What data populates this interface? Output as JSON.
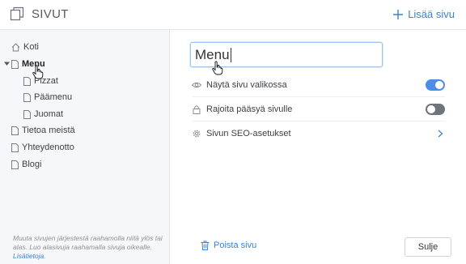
{
  "header": {
    "title": "SIVUT",
    "add_label": "Lisää sivu"
  },
  "sidebar": {
    "items": [
      {
        "label": "Koti",
        "icon": "home-icon"
      },
      {
        "label": "Menu",
        "icon": "page-icon",
        "active": true,
        "expanded": true
      },
      {
        "label": "Pizzat",
        "icon": "page-icon"
      },
      {
        "label": "Päämenu",
        "icon": "page-icon"
      },
      {
        "label": "Juomat",
        "icon": "page-icon"
      },
      {
        "label": "Tietoa meistä",
        "icon": "page-icon"
      },
      {
        "label": "Yhteydenotto",
        "icon": "page-icon"
      },
      {
        "label": "Blogi",
        "icon": "page-icon"
      }
    ],
    "note": {
      "text": "Muuta sivujen järjestestä raahamolla niitä ylös tai alas. Luo alasivuja raahamalla sivuja oikealle.",
      "link": "Lisätietoja."
    }
  },
  "editor": {
    "page_name_value": "Menu",
    "settings": [
      {
        "label": "Näytä sivu valikossa",
        "icon": "eye-icon",
        "control": "toggle",
        "on": true
      },
      {
        "label": "Rajoita pääsyä sivulle",
        "icon": "lock-icon",
        "control": "toggle",
        "on": false
      },
      {
        "label": "Sivun SEO-asetukset",
        "icon": "gear-icon",
        "control": "chevron"
      }
    ],
    "delete_label": "Poista sivu",
    "close_label": "Sulje"
  },
  "colors": {
    "accent": "#3b82d6",
    "toggle_on": "#4a8ee8",
    "toggle_off": "#6f747a",
    "sidebar_bg": "#f6f7f9"
  }
}
